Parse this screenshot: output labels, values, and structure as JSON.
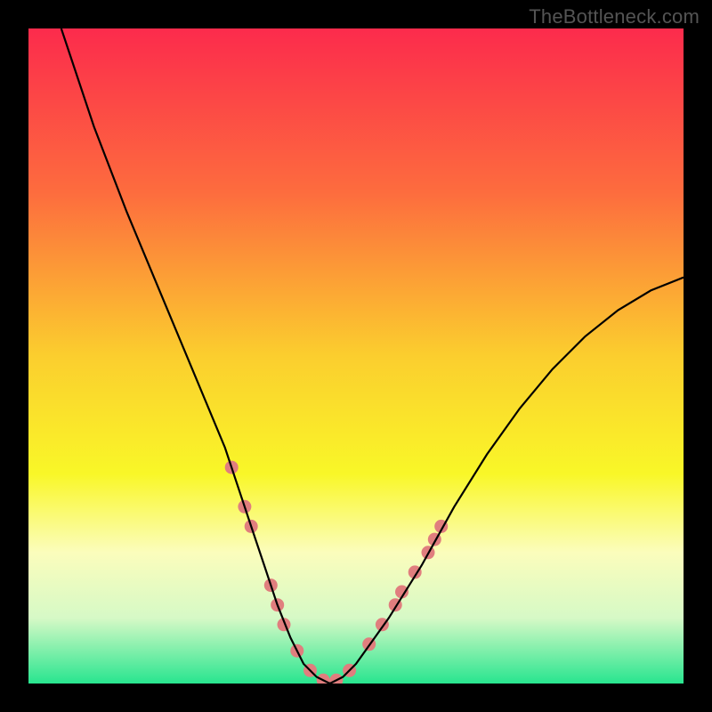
{
  "watermark": "TheBottleneck.com",
  "chart_data": {
    "type": "line",
    "title": "",
    "xlabel": "",
    "ylabel": "",
    "xlim": [
      0,
      100
    ],
    "ylim": [
      0,
      100
    ],
    "grid": false,
    "series": [
      {
        "name": "curve",
        "x": [
          5,
          10,
          15,
          20,
          25,
          30,
          32,
          34,
          36,
          38,
          40,
          42,
          44,
          46,
          48,
          50,
          55,
          60,
          65,
          70,
          75,
          80,
          85,
          90,
          95,
          100
        ],
        "y": [
          100,
          85,
          72,
          60,
          48,
          36,
          30,
          24,
          18,
          12,
          7,
          3,
          1,
          0,
          1,
          3,
          10,
          18,
          27,
          35,
          42,
          48,
          53,
          57,
          60,
          62
        ],
        "color": "#000000"
      }
    ],
    "scatter_points": {
      "name": "markers",
      "color": "#e07e7e",
      "points": [
        {
          "x": 31,
          "y": 33
        },
        {
          "x": 33,
          "y": 27
        },
        {
          "x": 34,
          "y": 24
        },
        {
          "x": 37,
          "y": 15
        },
        {
          "x": 38,
          "y": 12
        },
        {
          "x": 39,
          "y": 9
        },
        {
          "x": 41,
          "y": 5
        },
        {
          "x": 43,
          "y": 2
        },
        {
          "x": 45,
          "y": 0.5
        },
        {
          "x": 47,
          "y": 0.5
        },
        {
          "x": 49,
          "y": 2
        },
        {
          "x": 52,
          "y": 6
        },
        {
          "x": 54,
          "y": 9
        },
        {
          "x": 56,
          "y": 12
        },
        {
          "x": 57,
          "y": 14
        },
        {
          "x": 59,
          "y": 17
        },
        {
          "x": 61,
          "y": 20
        },
        {
          "x": 62,
          "y": 22
        },
        {
          "x": 63,
          "y": 24
        }
      ]
    },
    "background_gradient": {
      "stops": [
        {
          "offset": 0.0,
          "color": "#fc2b4c"
        },
        {
          "offset": 0.25,
          "color": "#fd6c3e"
        },
        {
          "offset": 0.5,
          "color": "#fbce2e"
        },
        {
          "offset": 0.68,
          "color": "#f9f728"
        },
        {
          "offset": 0.8,
          "color": "#fbfdbc"
        },
        {
          "offset": 0.9,
          "color": "#d6f9c6"
        },
        {
          "offset": 1.0,
          "color": "#28e58f"
        }
      ]
    }
  }
}
